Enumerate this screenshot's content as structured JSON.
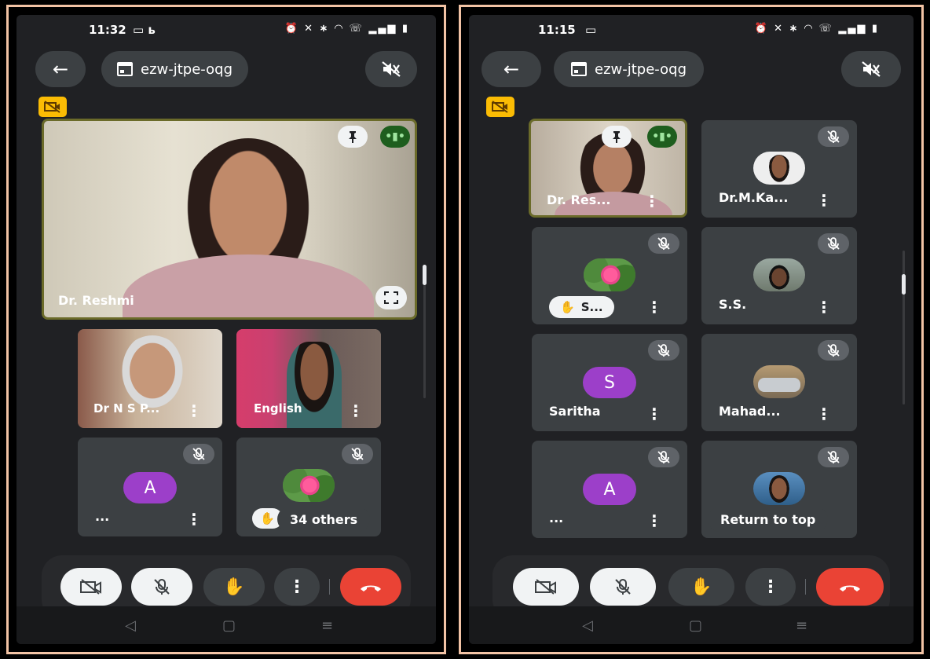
{
  "colors": {
    "frame_border": "#f2c3a5",
    "screen_bg": "#202124",
    "tile_bg": "#3c4043",
    "avatar_purple": "#9c3fc9",
    "end_call_red": "#ea4335",
    "no_camera_badge": "#fbbc04",
    "speaking_green": "#1e5e1e"
  },
  "left_screen": {
    "status": {
      "time": "11:32",
      "extra": "▭ ь"
    },
    "meeting_code": "ezw-jtpe-oqg",
    "pinned_tile": {
      "name": "Dr. Reshmi"
    },
    "tiles": [
      {
        "name": "Dr N S P..."
      },
      {
        "name": "English"
      },
      {
        "name": "...",
        "avatar_letter": "A"
      },
      {
        "name": ""
      }
    ],
    "others_chip": "34 others"
  },
  "right_screen": {
    "status": {
      "time": "11:15",
      "extra": "▭"
    },
    "meeting_code": "ezw-jtpe-oqg",
    "tiles": [
      {
        "name": "Dr. Res..."
      },
      {
        "name": "Dr.M.Ka..."
      },
      {
        "name": "S..."
      },
      {
        "name": "S.S."
      },
      {
        "name": "Saritha",
        "avatar_letter": "S"
      },
      {
        "name": "Mahad..."
      },
      {
        "name": "...",
        "avatar_letter": "A"
      },
      {
        "name": ""
      }
    ],
    "return_chip": "Return to top"
  },
  "icons": {
    "back": "arrow-left-icon",
    "calendar": "calendar-icon",
    "speaker_off": "speaker-off-icon",
    "camera_off": "camera-off-icon",
    "mic_off": "mic-off-icon",
    "raise_hand": "raise-hand-icon",
    "more": "more-vert-icon",
    "end_call": "end-call-icon",
    "pin": "pin-icon",
    "fullscreen": "fullscreen-icon"
  },
  "nav": {
    "back": "◁",
    "home": "▢",
    "recents": "≡"
  }
}
